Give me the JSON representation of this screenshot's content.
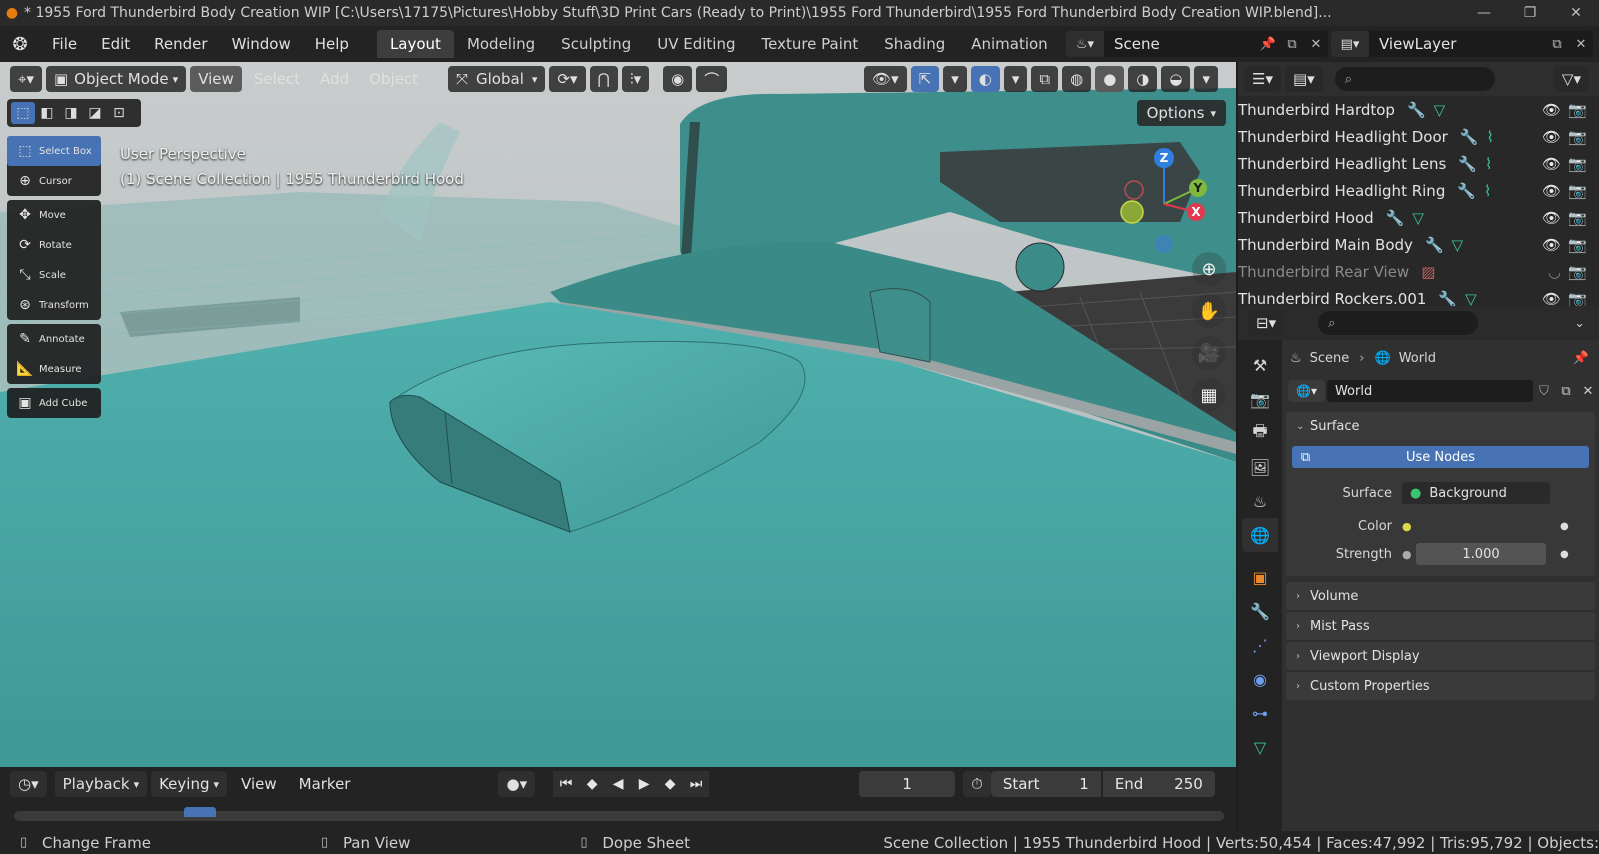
{
  "window": {
    "title": "* 1955 Ford Thunderbird Body Creation WIP [C:\\Users\\17175\\Pictures\\Hobby Stuff\\3D Print Cars (Ready to Print)\\1955 Ford Thunderbird\\1955 Ford Thunderbird Body Creation WIP.blend]...",
    "controls": {
      "minimize": "—",
      "maximize": "❐",
      "close": "✕"
    }
  },
  "menu": {
    "items": [
      "File",
      "Edit",
      "Render",
      "Window",
      "Help"
    ]
  },
  "workspaces": {
    "tabs": [
      "Layout",
      "Modeling",
      "Sculpting",
      "UV Editing",
      "Texture Paint",
      "Shading",
      "Animation"
    ],
    "active": "Layout"
  },
  "scene": {
    "name": "Scene"
  },
  "view_layer": {
    "name": "ViewLayer"
  },
  "viewport": {
    "mode": "Object Mode",
    "menus": [
      "View",
      "Select",
      "Add",
      "Object"
    ],
    "transform_orientation": "Global",
    "options_label": "Options",
    "info_line1": "User Perspective",
    "info_line2": "(1) Scene Collection | 1955 Thunderbird Hood",
    "gizmo": {
      "z": "Z",
      "y": "Y",
      "x": "X"
    }
  },
  "toolbar": {
    "tools": [
      {
        "label": "Select Box",
        "icon": "select-box-icon",
        "glyph": "⬚",
        "active": true
      },
      {
        "label": "Cursor",
        "icon": "cursor-icon",
        "glyph": "⊕",
        "active": false
      },
      {
        "label": "Move",
        "icon": "move-icon",
        "glyph": "✥",
        "active": false
      },
      {
        "label": "Rotate",
        "icon": "rotate-icon",
        "glyph": "⟳",
        "active": false
      },
      {
        "label": "Scale",
        "icon": "scale-icon",
        "glyph": "⤡",
        "active": false
      },
      {
        "label": "Transform",
        "icon": "transform-icon",
        "glyph": "⊛",
        "active": false
      },
      {
        "label": "Annotate",
        "icon": "annotate-icon",
        "glyph": "✎",
        "active": false
      },
      {
        "label": "Measure",
        "icon": "measure-icon",
        "glyph": "📐",
        "active": false
      },
      {
        "label": "Add Cube",
        "icon": "add-cube-icon",
        "glyph": "▣",
        "active": false
      }
    ]
  },
  "timeline": {
    "menus": [
      "Playback",
      "Keying",
      "View",
      "Marker"
    ],
    "current_frame": "1",
    "start_label": "Start",
    "start": "1",
    "end_label": "End",
    "end": "250"
  },
  "statusbar": {
    "hint1": "Change Frame",
    "hint2": "Pan View",
    "hint3": "Dope Sheet",
    "stats": "Scene Collection | 1955 Thunderbird Hood | Verts:50,454 | Faces:47,992 | Tris:95,792 | Objects:"
  },
  "outliner": {
    "rows": [
      {
        "name": "Thunderbird Hardtop",
        "dim": false
      },
      {
        "name": "Thunderbird Headlight Door",
        "dim": false
      },
      {
        "name": "Thunderbird Headlight Lens",
        "dim": false
      },
      {
        "name": "Thunderbird Headlight Ring",
        "dim": false
      },
      {
        "name": "Thunderbird Hood",
        "dim": false
      },
      {
        "name": "Thunderbird Main Body",
        "dim": false
      },
      {
        "name": "Thunderbird Rear View",
        "dim": true
      },
      {
        "name": "Thunderbird Rockers.001",
        "dim": false
      }
    ]
  },
  "properties": {
    "breadcrumb_scene": "Scene",
    "breadcrumb_world": "World",
    "world_name": "World",
    "surface_panel": "Surface",
    "use_nodes": "Use Nodes",
    "surface_label": "Surface",
    "surface_value": "Background",
    "color_label": "Color",
    "strength_label": "Strength",
    "strength_value": "1.000",
    "panels": [
      "Volume",
      "Mist Pass",
      "Viewport Display",
      "Custom Properties"
    ]
  },
  "colors": {
    "accent": "#4772b3",
    "viewport_body": "#4aa6a4",
    "mesh_icon": "#38c6a0",
    "modifier_icon": "#6d9ee8"
  }
}
